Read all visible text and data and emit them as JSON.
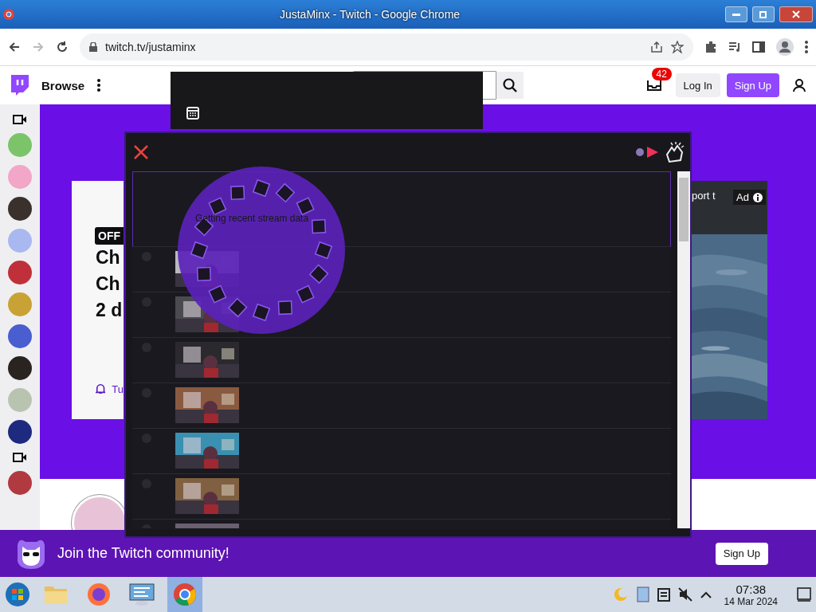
{
  "browser": {
    "title": "JustaMinx - Twitch - Google Chrome",
    "url": "twitch.tv/justaminx"
  },
  "twitch_nav": {
    "browse": "Browse",
    "inbox_count": "42",
    "log_in": "Log In",
    "sign_up": "Sign Up"
  },
  "sidebar": {
    "items": [
      {
        "kind": "camera"
      },
      {
        "kind": "avatar",
        "color": "#7cc46a"
      },
      {
        "kind": "avatar",
        "color": "#f2a6c8"
      },
      {
        "kind": "avatar",
        "color": "#3a302c"
      },
      {
        "kind": "avatar",
        "color": "#a9b8f0"
      },
      {
        "kind": "avatar",
        "color": "#c0303a"
      },
      {
        "kind": "avatar",
        "color": "#c9a236"
      },
      {
        "kind": "avatar",
        "color": "#4a5ed0"
      },
      {
        "kind": "avatar",
        "color": "#2a2420"
      },
      {
        "kind": "avatar",
        "color": "#b9c4b0"
      },
      {
        "kind": "avatar",
        "color": "#1e2a80"
      },
      {
        "kind": "camera"
      },
      {
        "kind": "avatar",
        "color": "#b03a40"
      }
    ]
  },
  "channel_card": {
    "badge": "OFF",
    "title_lines": [
      "Ch",
      "Ch",
      "2 d"
    ],
    "notify": "Tu"
  },
  "ad": {
    "text": "port t",
    "badge": "Ad"
  },
  "modal": {
    "loading": "Getting recent stream data",
    "rows": [
      {
        "kind": "placeholder"
      },
      {
        "kind": "picture"
      },
      {
        "kind": "picture"
      },
      {
        "kind": "picture"
      },
      {
        "kind": "picture"
      },
      {
        "kind": "picture"
      },
      {
        "kind": "picture"
      },
      {
        "kind": "picture"
      }
    ]
  },
  "join_bar": {
    "text": "Join the Twitch community!",
    "button": "Sign Up"
  },
  "taskbar": {
    "apps": [
      {
        "kind": "folder",
        "selected": false
      },
      {
        "kind": "firefox",
        "selected": false
      },
      {
        "kind": "control-panel",
        "selected": false
      },
      {
        "kind": "chrome",
        "selected": true
      }
    ],
    "time": "07:38",
    "date": "14 Mar 2024"
  }
}
